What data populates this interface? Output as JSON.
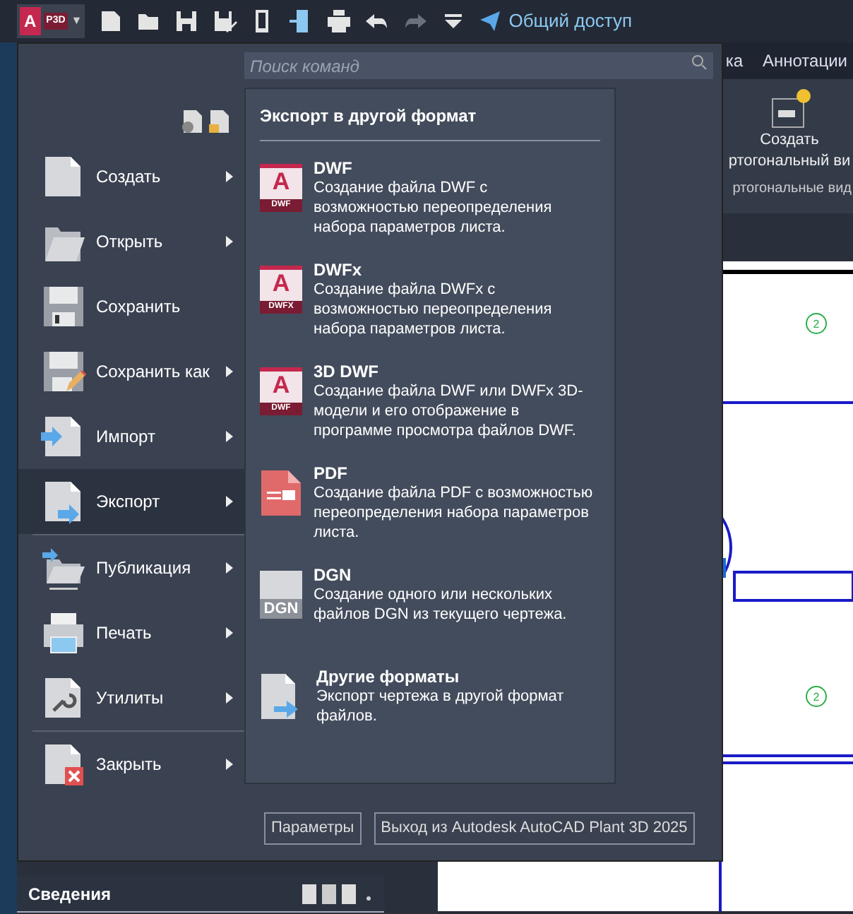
{
  "app_button": {
    "letter": "A",
    "badge": "P3D",
    "caret": "▼"
  },
  "quick_access": {
    "share_label": "Общий доступ"
  },
  "ribbon": {
    "tabs": [
      "ка",
      "Аннотации"
    ],
    "button_lines": [
      "Создать",
      "ртогональный ви"
    ],
    "group_label": "ртогональные вид"
  },
  "menu": {
    "search": {
      "placeholder": "Поиск команд"
    },
    "items": [
      {
        "kind": "new",
        "label": "Создать",
        "submenu": true,
        "selected": false,
        "separator_before": false
      },
      {
        "kind": "open",
        "label": "Открыть",
        "submenu": true,
        "selected": false,
        "separator_before": false
      },
      {
        "kind": "save",
        "label": "Сохранить",
        "submenu": false,
        "selected": false,
        "separator_before": false
      },
      {
        "kind": "saveas",
        "label": "Сохранить как",
        "submenu": true,
        "selected": false,
        "separator_before": false
      },
      {
        "kind": "import",
        "label": "Импорт",
        "submenu": true,
        "selected": false,
        "separator_before": false
      },
      {
        "kind": "export",
        "label": "Экспорт",
        "submenu": true,
        "selected": true,
        "separator_before": false
      },
      {
        "kind": "publish",
        "label": "Публикация",
        "submenu": true,
        "selected": false,
        "separator_before": true
      },
      {
        "kind": "print",
        "label": "Печать",
        "submenu": true,
        "selected": false,
        "separator_before": false
      },
      {
        "kind": "utilities",
        "label": "Утилиты",
        "submenu": true,
        "selected": false,
        "separator_before": false
      },
      {
        "kind": "close",
        "label": "Закрыть",
        "submenu": true,
        "selected": false,
        "separator_before": true
      }
    ],
    "submenu": {
      "title": "Экспорт в другой формат",
      "items": [
        {
          "kind": "dwf",
          "letter": "A",
          "badge": "DWF",
          "title": "DWF",
          "description": "Создание файла DWF с возможностью переопределения набора параметров листа."
        },
        {
          "kind": "dwf",
          "letter": "A",
          "badge": "DWFX",
          "title": "DWFx",
          "description": "Создание файла DWFx с возможностью переопределения набора параметров листа."
        },
        {
          "kind": "dwf",
          "letter": "A",
          "badge": "DWF",
          "title": "3D DWF",
          "description": "Создание файла DWF или DWFx 3D-модели и его отображение в программе просмотра файлов DWF."
        },
        {
          "kind": "pdf",
          "title": "PDF",
          "description": "Создание файла PDF с возможностью переопределения набора параметров листа."
        },
        {
          "kind": "dgn",
          "badge": "DGN",
          "title": "DGN",
          "description": "Создание одного или нескольких файлов DGN из текущего чертежа."
        },
        {
          "kind": "other",
          "title": "Другие форматы",
          "description": "Экспорт чертежа в другой формат файлов."
        }
      ]
    },
    "buttons": [
      "Параметры",
      "Выход из Autodesk AutoCAD Plant 3D 2025"
    ]
  },
  "palette": {
    "title": "Сведения"
  },
  "drawing": {
    "grid_labels": [
      "2",
      "2"
    ]
  }
}
